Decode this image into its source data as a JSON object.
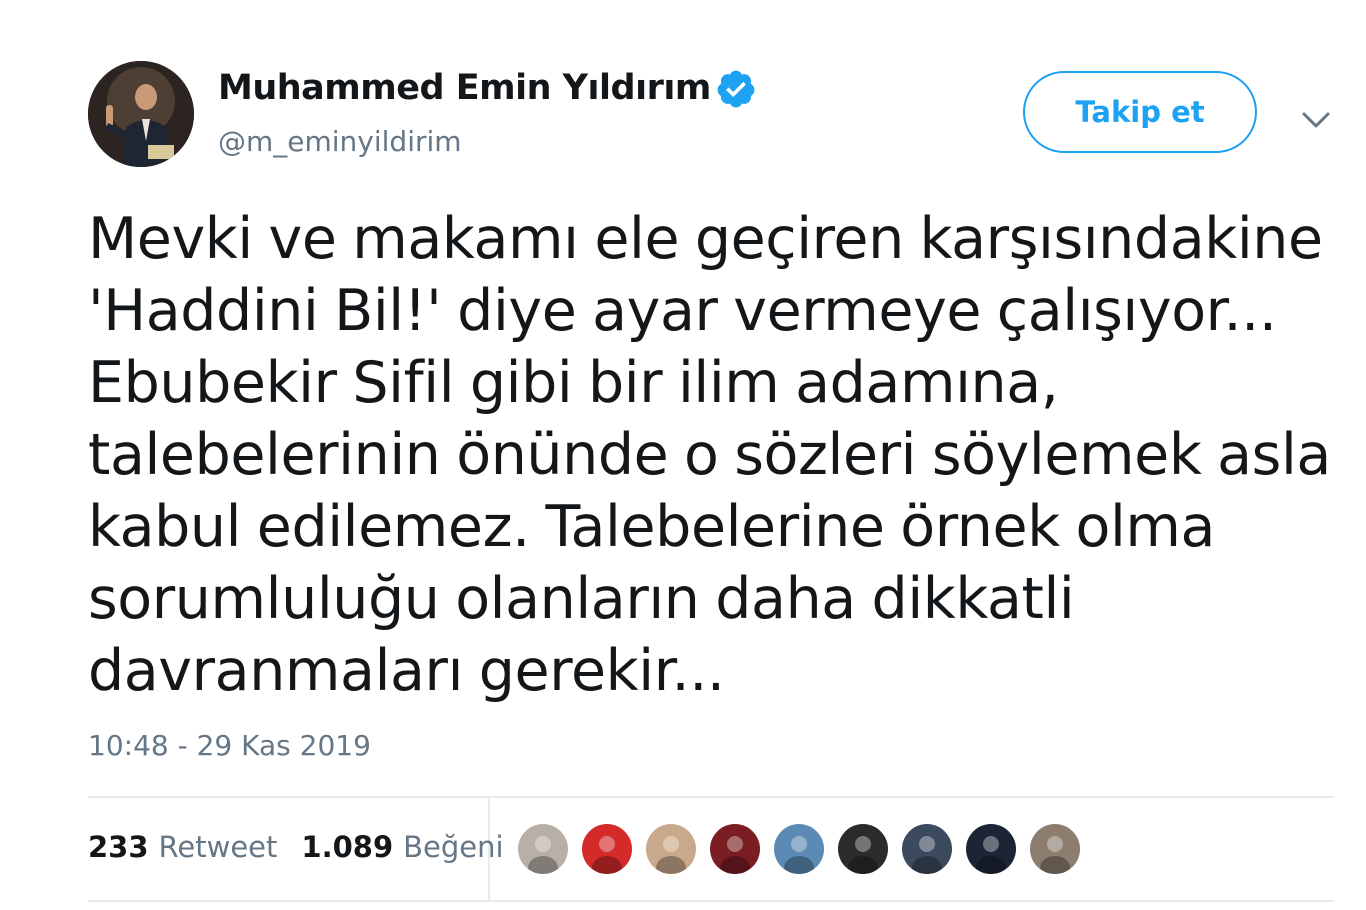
{
  "author": {
    "display_name": "Muhammed Emin Yıldırım",
    "handle": "@m_eminyildirim",
    "verified": true,
    "avatar_icon": "profile-photo"
  },
  "follow_button": {
    "label": "Takip et"
  },
  "menu": {
    "icon": "chevron-down-icon"
  },
  "tweet": {
    "lines": [
      "Mevki ve makamı ele geçiren karşısındakine",
      "'Haddini Bil!' diye ayar vermeye çalışıyor...",
      "Ebubekir Sifil gibi bir ilim adamına,",
      "talebelerinin önünde o sözleri söylemek asla",
      "kabul edilemez. Talebelerine örnek olma",
      "sorumluluğu olanların daha dikkatli",
      "davranmaları gerekir..."
    ]
  },
  "timestamp": "10:48 - 29 Kas 2019",
  "stats": {
    "retweets": {
      "count": "233",
      "label": "Retweet"
    },
    "likes": {
      "count": "1.089",
      "label": "Beğeni"
    }
  },
  "likers": [
    {
      "name": "liker-1",
      "color": "#b8b0a8"
    },
    {
      "name": "liker-2",
      "color": "#d42a2a"
    },
    {
      "name": "liker-3",
      "color": "#c9a98c"
    },
    {
      "name": "liker-4",
      "color": "#7a1e22"
    },
    {
      "name": "liker-5",
      "color": "#5b8bb4"
    },
    {
      "name": "liker-6",
      "color": "#2b2b2b"
    },
    {
      "name": "liker-7",
      "color": "#3c4a5e"
    },
    {
      "name": "liker-8",
      "color": "#1c2436"
    },
    {
      "name": "liker-9",
      "color": "#8c7d6e"
    }
  ],
  "colors": {
    "accent": "#1da1f2",
    "text": "#14171a",
    "secondary": "#657786",
    "divider": "#e6ecf0"
  }
}
